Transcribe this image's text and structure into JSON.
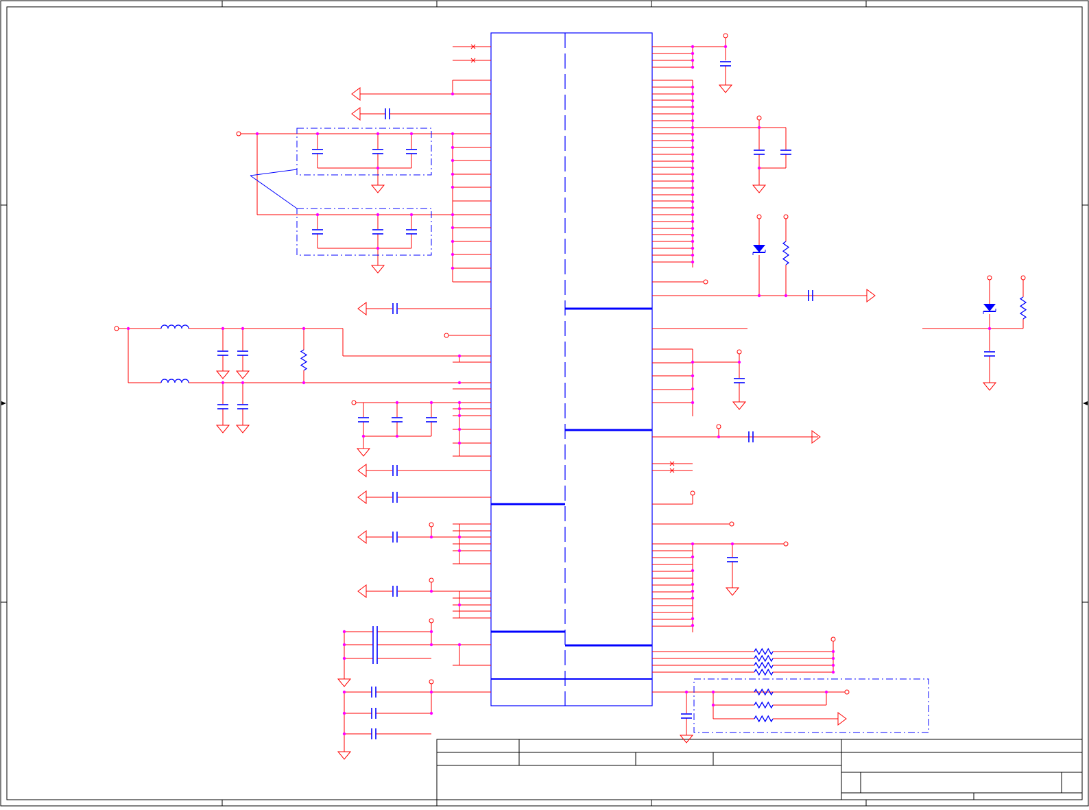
{
  "sheet": {
    "type": "schematic",
    "zone_columns": 5,
    "zone_rows": 4,
    "colors": {
      "wire": "#ff0000",
      "net": "#800080",
      "component": "#0000ff",
      "junction": "#ff00ff",
      "border": "#000000",
      "annotation_line": "#0000ff"
    }
  },
  "title_block": {
    "cells": []
  }
}
